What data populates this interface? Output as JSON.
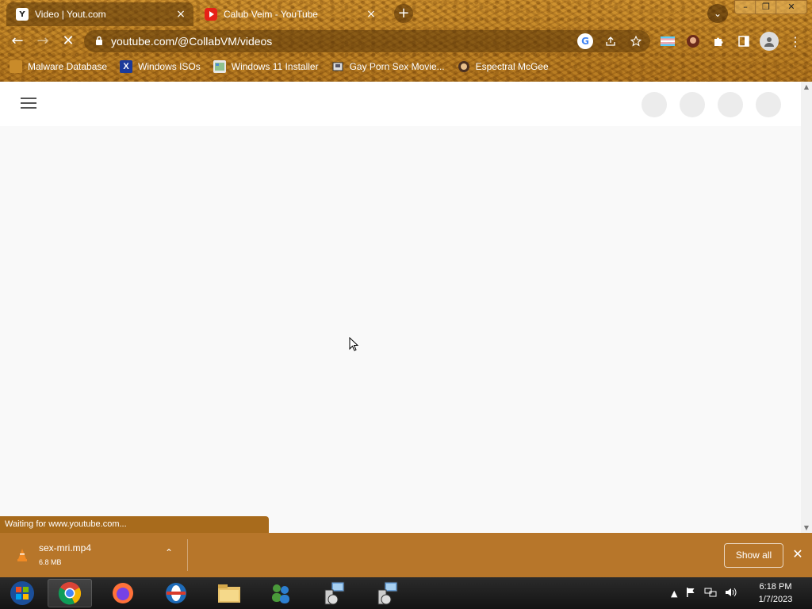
{
  "tabs": [
    {
      "title": "Video | Yout.com",
      "icon": "yout-favicon",
      "active": true,
      "close_label": "×"
    },
    {
      "title": "Calub Veim - YouTube",
      "icon": "youtube-favicon",
      "active": false,
      "close_label": "×"
    }
  ],
  "new_tab_label": "+",
  "tab_search_label": "⌄",
  "window_controls": {
    "minimize": "–",
    "maximize": "❐",
    "close": "✕"
  },
  "toolbar": {
    "back_label": "←",
    "forward_label": "→",
    "reload_label": "✕",
    "lock_label": "🔒",
    "url": "youtube.com/@CollabVM/videos",
    "google_label": "G"
  },
  "bookmarks": [
    {
      "label": "Malware Database",
      "icon": "malware-icon"
    },
    {
      "label": "Windows ISOs",
      "icon": "x-icon"
    },
    {
      "label": "Windows 11 Installer",
      "icon": "installer-icon"
    },
    {
      "label": "Gay Porn Sex Movie...",
      "icon": "disk-icon"
    },
    {
      "label": "Espectral McGee",
      "icon": "avatar-icon"
    }
  ],
  "status_text": "Waiting for www.youtube.com...",
  "download": {
    "filename": "sex-mri.mp4",
    "size": "6.8 MB",
    "show_all_label": "Show all",
    "close_label": "✕",
    "chevron_label": "⌃"
  },
  "clock": {
    "time": "6:18 PM",
    "date": "1/7/2023"
  },
  "colors": {
    "theme": "#b7762a",
    "page_bg": "#f9f9f9",
    "taskbar": "#1a1a1a"
  }
}
